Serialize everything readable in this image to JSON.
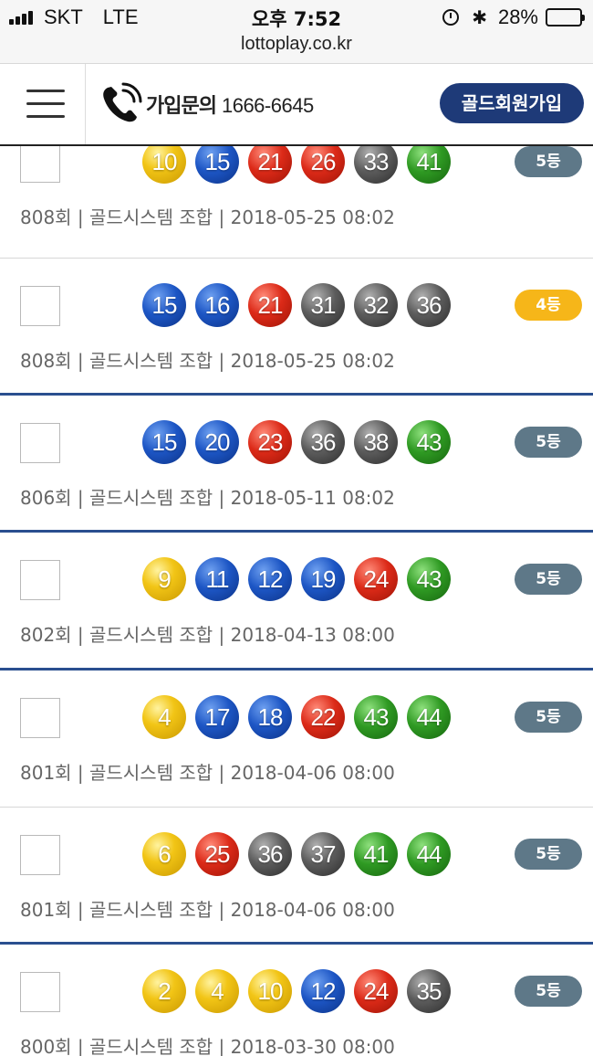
{
  "status_bar": {
    "carrier": "SKT",
    "network": "LTE",
    "time": "오후 7:52",
    "battery": "28%",
    "battery_level": 0.28,
    "bluetooth_glyph": "✱"
  },
  "browser": {
    "url": "lottoplay.co.kr"
  },
  "header": {
    "contact_label": "가입문의",
    "contact_number": "1666-6645",
    "join_button": "골드회원가입"
  },
  "colors": {
    "header_button": "#1e3a78",
    "rank_default": "#5e7888",
    "rank_highlight": "#f6b619",
    "separator_blue": "#2a4f8f"
  },
  "entries": [
    {
      "balls": [
        {
          "n": "10",
          "c": "yellow"
        },
        {
          "n": "15",
          "c": "blue"
        },
        {
          "n": "21",
          "c": "red"
        },
        {
          "n": "26",
          "c": "red"
        },
        {
          "n": "33",
          "c": "gray"
        },
        {
          "n": "41",
          "c": "green"
        }
      ],
      "rank": "5등",
      "rank_style": "default",
      "meta": "808회 | 골드시스템 조합 | 2018-05-25 08:02"
    },
    {
      "balls": [
        {
          "n": "15",
          "c": "blue"
        },
        {
          "n": "16",
          "c": "blue"
        },
        {
          "n": "21",
          "c": "red"
        },
        {
          "n": "31",
          "c": "gray"
        },
        {
          "n": "32",
          "c": "gray"
        },
        {
          "n": "36",
          "c": "gray"
        }
      ],
      "rank": "4등",
      "rank_style": "gold",
      "meta": "808회 | 골드시스템 조합 | 2018-05-25 08:02"
    },
    {
      "balls": [
        {
          "n": "15",
          "c": "blue"
        },
        {
          "n": "20",
          "c": "blue"
        },
        {
          "n": "23",
          "c": "red"
        },
        {
          "n": "36",
          "c": "gray"
        },
        {
          "n": "38",
          "c": "gray"
        },
        {
          "n": "43",
          "c": "green"
        }
      ],
      "rank": "5등",
      "rank_style": "default",
      "meta": "806회 | 골드시스템 조합 | 2018-05-11 08:02"
    },
    {
      "balls": [
        {
          "n": "9",
          "c": "yellow"
        },
        {
          "n": "11",
          "c": "blue"
        },
        {
          "n": "12",
          "c": "blue"
        },
        {
          "n": "19",
          "c": "blue"
        },
        {
          "n": "24",
          "c": "red"
        },
        {
          "n": "43",
          "c": "green"
        }
      ],
      "rank": "5등",
      "rank_style": "default",
      "meta": "802회 | 골드시스템 조합 | 2018-04-13 08:00"
    },
    {
      "balls": [
        {
          "n": "4",
          "c": "yellow"
        },
        {
          "n": "17",
          "c": "blue"
        },
        {
          "n": "18",
          "c": "blue"
        },
        {
          "n": "22",
          "c": "red"
        },
        {
          "n": "43",
          "c": "green"
        },
        {
          "n": "44",
          "c": "green"
        }
      ],
      "rank": "5등",
      "rank_style": "default",
      "meta": "801회 | 골드시스템 조합 | 2018-04-06 08:00"
    },
    {
      "balls": [
        {
          "n": "6",
          "c": "yellow"
        },
        {
          "n": "25",
          "c": "red"
        },
        {
          "n": "36",
          "c": "gray"
        },
        {
          "n": "37",
          "c": "gray"
        },
        {
          "n": "41",
          "c": "green"
        },
        {
          "n": "44",
          "c": "green"
        }
      ],
      "rank": "5등",
      "rank_style": "default",
      "meta": "801회 | 골드시스템 조합 | 2018-04-06 08:00"
    },
    {
      "balls": [
        {
          "n": "2",
          "c": "yellow"
        },
        {
          "n": "4",
          "c": "yellow"
        },
        {
          "n": "10",
          "c": "yellow"
        },
        {
          "n": "12",
          "c": "blue"
        },
        {
          "n": "24",
          "c": "red"
        },
        {
          "n": "35",
          "c": "gray"
        }
      ],
      "rank": "5등",
      "rank_style": "default",
      "meta": "800회 | 골드시스템 조합 | 2018-03-30 08:00"
    }
  ]
}
